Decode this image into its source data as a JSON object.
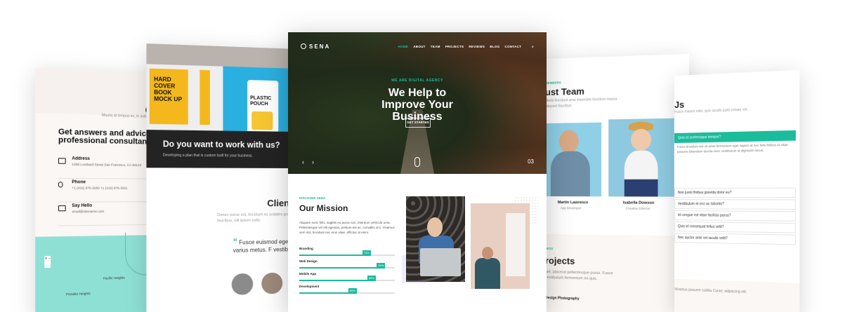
{
  "contact_page": {
    "title_partial": "G",
    "lorem": "Mauris at tempus ex, in sollicitudin",
    "heading": "Get answers and advices from professional consultants.",
    "rows": [
      {
        "label": "Address",
        "value": "1456 Lombard Street San Francisco, CA 94123"
      },
      {
        "label": "Phone",
        "value": "+1 (415) 876-3250 +1 (415) 876-3251"
      },
      {
        "label": "Say Hello",
        "value": "email@sitename.com"
      }
    ],
    "map_zoom": "+ -",
    "map_labels": [
      "Pacific Heights",
      "Presidio Heights"
    ]
  },
  "portfolio_page": {
    "book_text": "HARD COVER BOOK MOCK UP",
    "pouch_text": "PLASTIC POUCH",
    "cta_title": "Do you want to work with us?",
    "cta_sub": "Developing a plan that is custom built for your business.",
    "clients_title": "Clien",
    "clients_text": "Donec purus est, tincidunt eu sodales gravida faucibus, elit ipsum sollic",
    "quote_mark": "“",
    "quote": "Fusce euismod ege in varius metus. F vestibulum"
  },
  "main_page": {
    "logo": "SENA",
    "menu": [
      "HOME",
      "ABOUT",
      "TEAM",
      "PROJECTS",
      "REVIEWS",
      "BLOG",
      "CONTACT"
    ],
    "search_icon": "⌕",
    "eyebrow": "WE ARE DIGITAL AGENCY",
    "hero_title": "We Help to Improve Your Business",
    "cta": "GET STARTED",
    "prev": "‹",
    "next": "›",
    "slide_number": "03",
    "discover": "DISCOVER SENA",
    "mission_title": "Our Mission",
    "mission_text": "Aliquam nunc felis, sagittis eu purus non, interdum vehicula urna. Pellentesque vel elit egestas, pretium est ac, convallis orci. Vivamus sem nisl, tincidunt nec eros vitae, efficitur at enim.",
    "skills": [
      {
        "label": "Branding",
        "percent": 75,
        "badge": "75%"
      },
      {
        "label": "Web Design",
        "percent": 90,
        "badge": "90%"
      },
      {
        "label": "Mobile App",
        "percent": 80,
        "badge": "80%"
      },
      {
        "label": "Development",
        "percent": 60,
        "badge": "60%"
      }
    ],
    "accent": "#1abc9c"
  },
  "team_page": {
    "eyebrow": "MEMBERS",
    "title": "ust Team",
    "sub": "Morbi tincidunt urna imperdiet tincidunt massa aliquam faucibus.",
    "members": [
      {
        "name": "Martin Lawrence",
        "role": "App Developer"
      },
      {
        "name": "Isabella Dowson",
        "role": "Creative Director"
      }
    ],
    "proj_eyebrow": "WOO",
    "proj_title": "rojects",
    "proj_text": "get, placerat pellentesque purus. Fusce vestibulum fermentum mi quis.",
    "tabs": "Design       Photography"
  },
  "faq_page": {
    "title": "Js",
    "sub": "Fusce mauris odio, quis iaculis justo ornare vel.",
    "questions": [
      "Quis id scelerisque tempor?",
      "Non justo finibus gravida dolor eu?",
      "Vestibulum et orci ac lobortis?",
      "Id congue est vitae facilisis purus?",
      "Quis id consequat tellus velit?",
      "Nec auctor ante vel iaculis velit?"
    ],
    "answer": "Fusce tincidunt nisi sit amet fermentum eget sapien et nec felis finibus et vitae posuere bibendum lacinia nunc vestibulum id dignissim lacus.",
    "band_text": "Vivamus posuere cubilia Curae; adipiscing elit."
  }
}
